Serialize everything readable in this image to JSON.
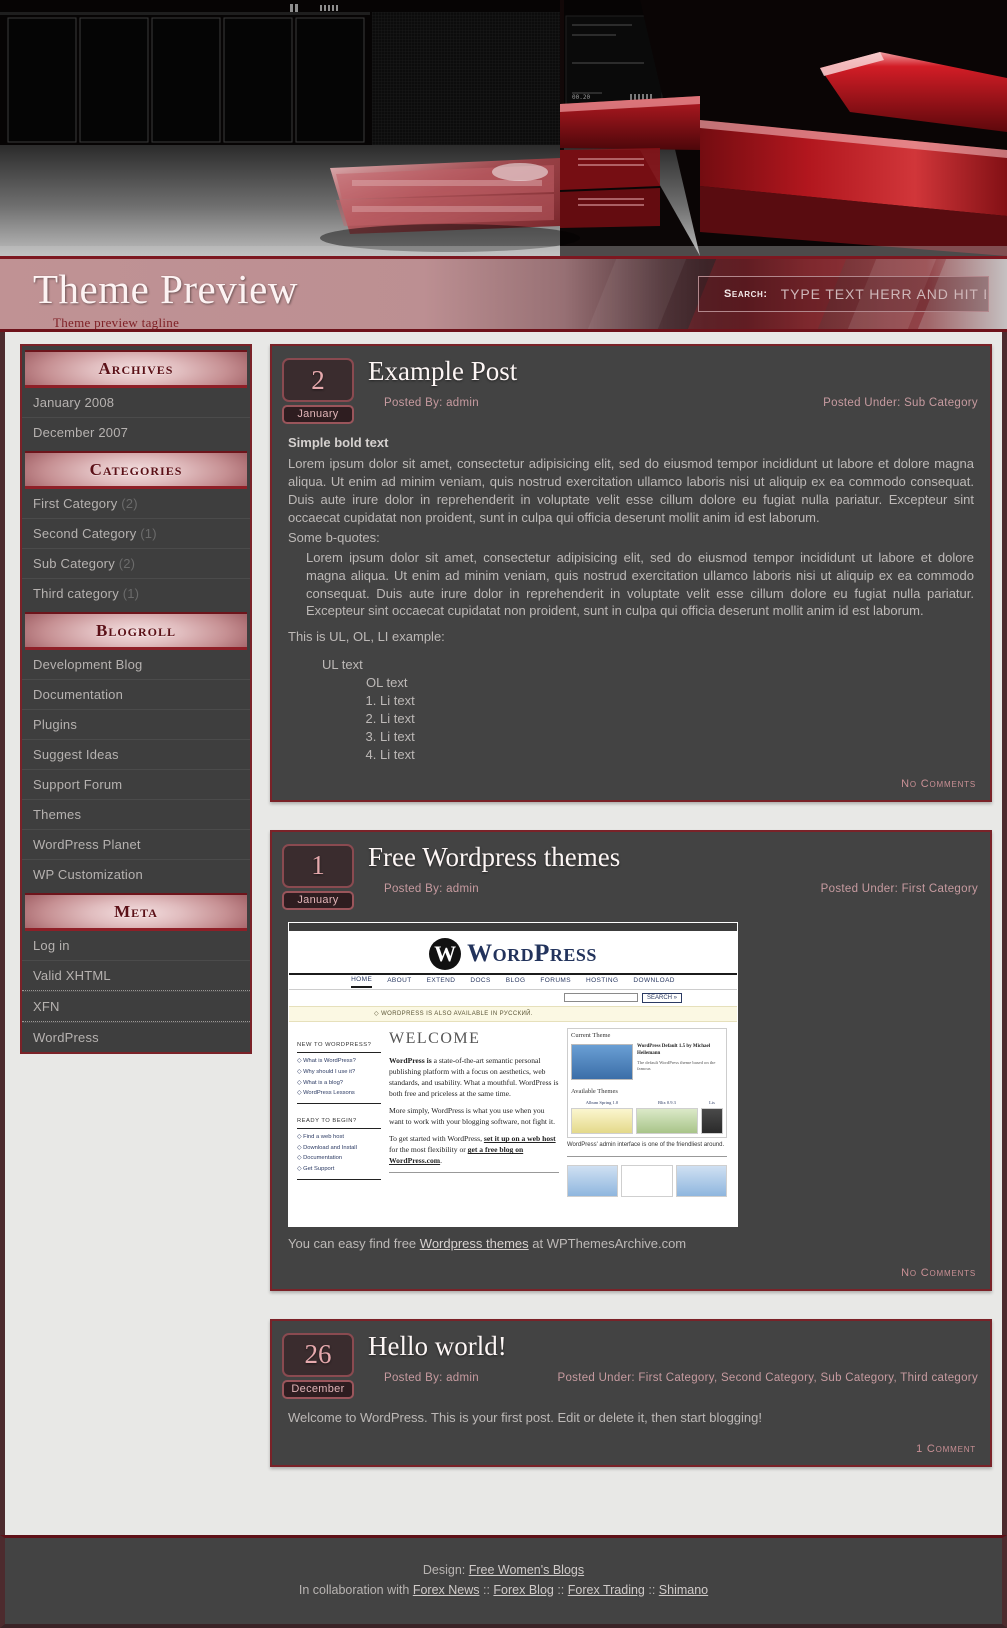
{
  "header": {
    "site_title": "Theme Preview",
    "tagline": "Theme preview tagline",
    "search_label": "Search:",
    "search_placeholder": "TYPE TEXT HERR AND HIT ENTER!",
    "search_value": ""
  },
  "colors": {
    "accent_red": "#7a2228",
    "dark_red": "#5f1118",
    "panel_bg": "#434343",
    "page_bg": "#e8e8e6",
    "link_pink": "#c79ba0"
  },
  "sidebar": {
    "widgets": [
      {
        "title": "Archives",
        "items": [
          {
            "label": "January 2008",
            "count": ""
          },
          {
            "label": "December 2007",
            "count": ""
          }
        ]
      },
      {
        "title": "Categories",
        "items": [
          {
            "label": "First Category",
            "count": "(2)"
          },
          {
            "label": "Second Category",
            "count": "(1)"
          },
          {
            "label": "Sub Category",
            "count": "(2)"
          },
          {
            "label": "Third category",
            "count": "(1)"
          }
        ]
      },
      {
        "title": "Blogroll",
        "items": [
          {
            "label": "Development Blog",
            "count": ""
          },
          {
            "label": "Documentation",
            "count": ""
          },
          {
            "label": "Plugins",
            "count": ""
          },
          {
            "label": "Suggest Ideas",
            "count": ""
          },
          {
            "label": "Support Forum",
            "count": ""
          },
          {
            "label": "Themes",
            "count": ""
          },
          {
            "label": "WordPress Planet",
            "count": ""
          },
          {
            "label": "WP Customization",
            "count": ""
          }
        ]
      },
      {
        "title": "Meta",
        "items": [
          {
            "label": "Log in",
            "count": ""
          },
          {
            "label": "Valid XHTML",
            "count": ""
          },
          {
            "label": "XFN",
            "count": ""
          },
          {
            "label": "WordPress",
            "count": ""
          }
        ]
      }
    ]
  },
  "posts": [
    {
      "day": "2",
      "month": "January",
      "title": "Example Post",
      "posted_by": "Posted By: admin",
      "posted_under": "Posted Under: Sub Category",
      "bold_lead": "Simple bold text",
      "para1": "Lorem ipsum dolor sit amet, consectetur adipisicing elit, sed do eiusmod tempor incididunt ut labore et dolore magna aliqua. Ut enim ad minim veniam, quis nostrud exercitation ullamco laboris nisi ut aliquip ex ea commodo consequat. Duis aute irure dolor in reprehenderit in voluptate velit esse cillum dolore eu fugiat nulla pariatur. Excepteur sint occaecat cupidatat non proident, sunt in culpa qui officia deserunt mollit anim id est laborum.",
      "bquote_intro": "Some b-quotes:",
      "blockquote": "Lorem ipsum dolor sit amet, consectetur adipisicing elit, sed do eiusmod tempor incididunt ut labore et dolore magna aliqua. Ut enim ad minim veniam, quis nostrud exercitation ullamco laboris nisi ut aliquip ex ea commodo consequat. Duis aute irure dolor in reprehenderit in voluptate velit esse cillum dolore eu fugiat nulla pariatur. Excepteur sint occaecat cupidatat non proident, sunt in culpa qui officia deserunt mollit anim id est laborum.",
      "list_intro": "This is UL, OL, LI example:",
      "ul_text": "UL text",
      "ol_text": "OL text",
      "li_items": [
        "Li text",
        "Li text",
        "Li text",
        "Li text"
      ],
      "comments": "No Comments"
    },
    {
      "day": "1",
      "month": "January",
      "title": "Free Wordpress themes",
      "posted_by": "Posted By: admin",
      "posted_under": "Posted Under: First Category",
      "caption_pre": "You can easy find free ",
      "caption_link": "Wordpress themes",
      "caption_post": " at WPThemesArchive.com",
      "comments": "No Comments"
    },
    {
      "day": "26",
      "month": "December",
      "title": "Hello world!",
      "posted_by": "Posted By: admin",
      "posted_under": "Posted Under: First Category, Second Category, Sub Category, Third category",
      "body": "Welcome to WordPress. This is your first post. Edit or delete it, then start blogging!",
      "comments": "1 Comment"
    }
  ],
  "wp_screenshot": {
    "logo_mark": "W",
    "logo_word": "WordPress",
    "nav": [
      "HOME",
      "ABOUT",
      "EXTEND",
      "DOCS",
      "BLOG",
      "FORUMS",
      "HOSTING",
      "DOWNLOAD"
    ],
    "search_button": "SEARCH »",
    "notice": "◇ WORDPRESS IS ALSO AVAILABLE IN РУССКИЙ.",
    "welcome": "WELCOME",
    "para1_bold": "WordPress is",
    "para1": " a state-of-the-art semantic personal publishing platform with a focus on aesthetics, web standards, and usability. What a mouthful. WordPress is both free and priceless at the same time.",
    "para2": "More simply, WordPress is what you use when you want to work with your blogging software, not fight it.",
    "para3_pre": "To get started with WordPress, ",
    "para3_link1": "set it up on a web host",
    "para3_mid": " for the most flexibility or ",
    "para3_link2": "get a free blog on WordPress.com",
    "para3_end": ".",
    "side1_title": "NEW TO WORDPRESS?",
    "side1_items": [
      "◇ What is WordPress?",
      "◇ Why should I use it?",
      "◇ What is a blog?",
      "◇ WordPress Lessons"
    ],
    "side2_title": "READY TO BEGIN?",
    "side2_items": [
      "◇ Find a web host",
      "◇ Download and Install",
      "◇ Documentation",
      "◇ Get Support"
    ],
    "panel_title_current": "Current Theme",
    "panel_theme_name": "WordPress Default 1.5 by Michael Heilemann",
    "panel_theme_desc": "The default WordPress theme based on the famous",
    "panel_title_available": "Available Themes",
    "available_themes": [
      "Album Spring 1.0",
      "Blix 0.9.3",
      "Lis"
    ],
    "admin_caption": "WordPress' admin interface is one of the friendliest around."
  },
  "footer": {
    "design_label": "Design: ",
    "design_link": "Free Women's Blogs",
    "collab_label": "In collaboration with ",
    "links": [
      "Forex News",
      "Forex Blog",
      "Forex Trading",
      "Shimano"
    ],
    "separator": " :: "
  }
}
